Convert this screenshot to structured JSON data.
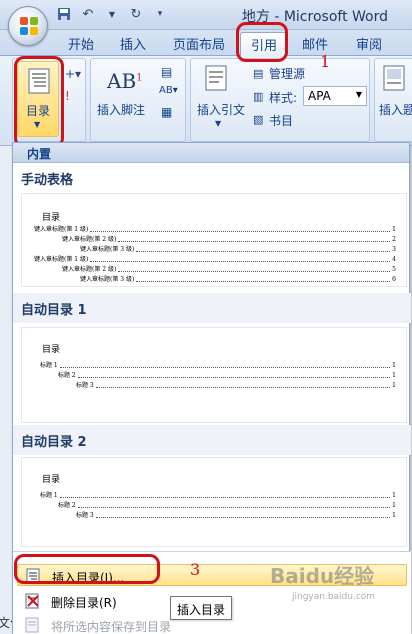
{
  "window": {
    "title": "地方 - Microsoft Word"
  },
  "tabs": [
    "开始",
    "插入",
    "页面布局",
    "引用",
    "邮件",
    "审阅"
  ],
  "ribbon": {
    "toc_label": "目录",
    "footnote_label": "插入脚注",
    "citation_label": "插入引文",
    "caption_label": "插入题",
    "manage_sources": "管理源",
    "style_label": "样式:",
    "style_value": "APA",
    "bibliography": "书目"
  },
  "panel": {
    "header": "内置",
    "sections": [
      {
        "title": "手动表格",
        "heading": "目录",
        "lines": [
          {
            "text": "键入章标题(第 1 级)",
            "page": "1"
          },
          {
            "text": "键入章标题(第 2 级)",
            "page": "2"
          },
          {
            "text": "键入章标题(第 3 级)",
            "page": "3"
          },
          {
            "text": "键入章标题(第 1 级)",
            "page": "4"
          },
          {
            "text": "键入章标题(第 2 级)",
            "page": "5"
          },
          {
            "text": "键入章标题(第 3 级)",
            "page": "6"
          }
        ]
      },
      {
        "title": "自动目录 1",
        "heading": "目录",
        "lines": [
          {
            "text": "标题 1",
            "page": "1"
          },
          {
            "text": "标题 2",
            "page": "1"
          },
          {
            "text": "标题 3",
            "page": "1"
          }
        ]
      },
      {
        "title": "自动目录 2",
        "heading": "目录",
        "lines": [
          {
            "text": "标题 1",
            "page": "1"
          },
          {
            "text": "标题 2",
            "page": "1"
          },
          {
            "text": "标题 3",
            "page": "1"
          }
        ]
      }
    ],
    "menu": {
      "insert_toc": "插入目录(I)...",
      "remove_toc": "删除目录(R)",
      "save_selection": "将所选内容保存到目录"
    }
  },
  "tooltip": "插入目录",
  "annotations": [
    "1",
    "2",
    "3"
  ],
  "watermark": {
    "main": "Baidu经验",
    "sub": "jingyan.baidu.com"
  },
  "doc_fragment": "文化",
  "colors": {
    "annotation": "#d2111b",
    "hover": "#ffe28a",
    "ribbon": "#d3e1f2"
  }
}
